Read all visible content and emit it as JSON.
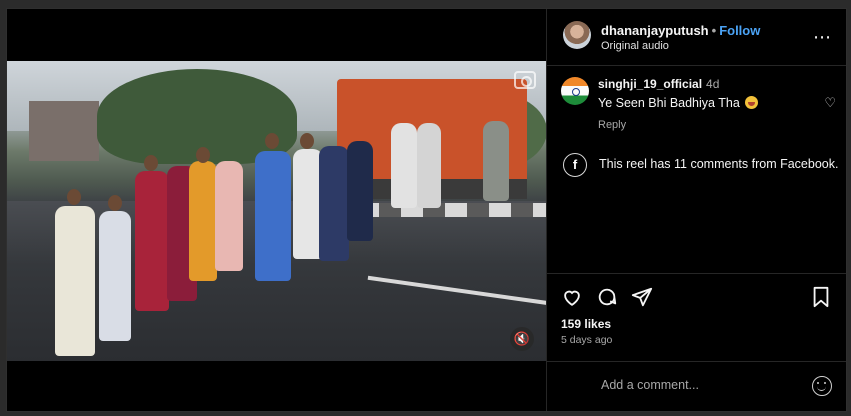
{
  "post": {
    "username": "dhananjayputush",
    "separator": "•",
    "follow_label": "Follow",
    "audio": "Original audio",
    "more_glyph": "⋯"
  },
  "comments": [
    {
      "username": "singhji_19_official",
      "time": "4d",
      "text": "Ye Seen Bhi Badhiya Tha",
      "reply_label": "Reply"
    }
  ],
  "facebook_notice": {
    "text": "This reel has 11 comments from Facebook.",
    "icon": "facebook-icon"
  },
  "actions": {
    "like_icon": "heart-icon",
    "comment_icon": "comment-icon",
    "share_icon": "share-icon",
    "save_icon": "bookmark-icon"
  },
  "stats": {
    "likes": "159 likes",
    "posted_ago": "5 days ago"
  },
  "add_comment": {
    "placeholder": "Add a comment..."
  },
  "colors": {
    "accent": "#4ba3f5",
    "background": "#000000",
    "muted_text": "#a8a8a8"
  }
}
